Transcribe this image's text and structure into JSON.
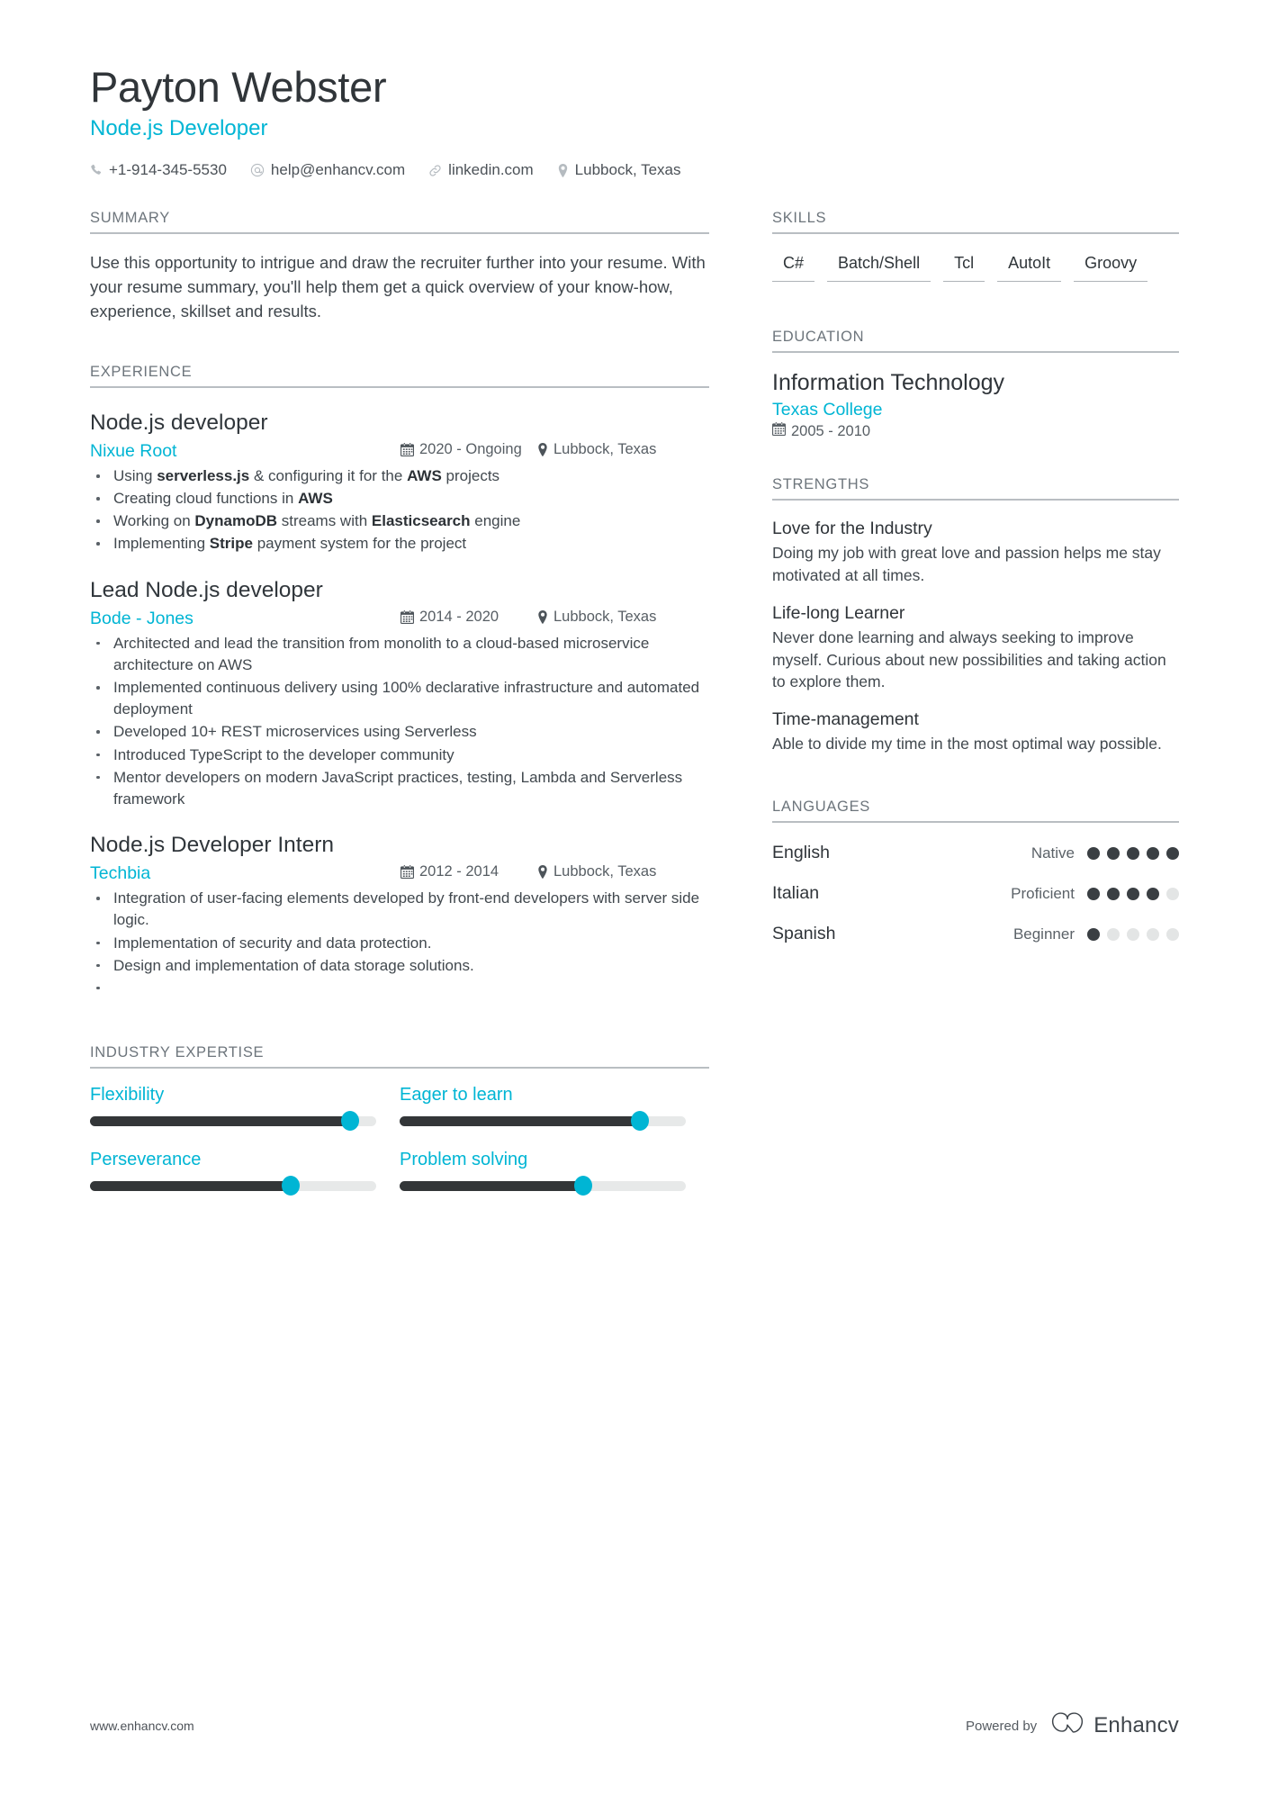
{
  "header": {
    "name": "Payton Webster",
    "job_title": "Node.js Developer",
    "contacts": [
      {
        "icon": "phone-icon",
        "text": "+1-914-345-5530"
      },
      {
        "icon": "email-icon",
        "text": "help@enhancv.com"
      },
      {
        "icon": "link-icon",
        "text": "linkedin.com"
      },
      {
        "icon": "location-icon",
        "text": "Lubbock, Texas"
      }
    ]
  },
  "colors": {
    "accent": "#00b5d4",
    "heading": "#6d757c",
    "text": "#3f464c",
    "slider_fill": "#333638",
    "slider_track": "#e7e9e9",
    "dot_on": "#3a3f43",
    "dot_off": "#e3e5e5"
  },
  "summary": {
    "heading": "SUMMARY",
    "text": "Use this opportunity to intrigue and draw the recruiter further into your resume. With your resume summary, you'll help them get a quick overview of your know-how, experience, skillset and results."
  },
  "experience": {
    "heading": "EXPERIENCE",
    "items": [
      {
        "title": "Node.js developer",
        "company": "Nixue Root",
        "date": "2020 - Ongoing",
        "location": "Lubbock, Texas",
        "bullets": [
          "Using <b>serverless.js</b> &amp; configuring it for the <b>AWS</b> projects",
          "Creating cloud functions in <b>AWS</b>",
          "Working on <b>DynamoDB</b> streams with <b>Elasticsearch</b> engine",
          "Implementing <b>Stripe</b> payment system for the project"
        ]
      },
      {
        "title": "Lead Node.js developer",
        "company": "Bode - Jones",
        "date": "2014 - 2020",
        "location": "Lubbock, Texas",
        "bullets": [
          "Architected and lead the transition from monolith to a cloud-based microservice architecture on AWS",
          "Implemented continuous delivery using 100% declarative infrastructure and automated deployment",
          "Developed 10+ REST microservices using Serverless",
          "Introduced TypeScript to the developer community",
          "Mentor developers on modern JavaScript practices, testing, Lambda and Serverless framework"
        ]
      },
      {
        "title": "Node.js Developer Intern",
        "company": "Techbia",
        "date": "2012 - 2014",
        "location": "Lubbock, Texas",
        "bullets": [
          "Integration of user-facing elements developed by front-end developers with server side logic.",
          "Implementation of security and data protection.",
          "Design and implementation of data storage solutions.",
          ""
        ]
      }
    ]
  },
  "industry_expertise": {
    "heading": "INDUSTRY EXPERTISE",
    "items": [
      {
        "label": "Flexibility",
        "value": 91
      },
      {
        "label": "Eager to learn",
        "value": 84
      },
      {
        "label": "Perseverance",
        "value": 70
      },
      {
        "label": "Problem solving",
        "value": 64
      }
    ]
  },
  "skills": {
    "heading": "SKILLS",
    "items": [
      "C#",
      "Batch/Shell",
      "Tcl",
      "AutoIt",
      "Groovy"
    ]
  },
  "education": {
    "heading": "EDUCATION",
    "items": [
      {
        "degree": "Information Technology",
        "school": "Texas College",
        "date": "2005 - 2010"
      }
    ]
  },
  "strengths": {
    "heading": "STRENGTHS",
    "items": [
      {
        "title": "Love for the Industry",
        "desc": "Doing my job with great love and passion helps me stay motivated at all times."
      },
      {
        "title": "Life-long Learner",
        "desc": "Never done learning and always seeking to improve myself. Curious about new possibilities and taking action to explore them."
      },
      {
        "title": "Time-management",
        "desc": "Able to divide my time in the most optimal way possible."
      }
    ]
  },
  "languages": {
    "heading": "LANGUAGES",
    "items": [
      {
        "name": "English",
        "level": "Native",
        "filled": 5,
        "total": 5
      },
      {
        "name": "Italian",
        "level": "Proficient",
        "filled": 4,
        "total": 5
      },
      {
        "name": "Spanish",
        "level": "Beginner",
        "filled": 1,
        "total": 5
      }
    ]
  },
  "footer": {
    "website": "www.enhancv.com",
    "powered_by": "Powered by",
    "brand": "Enhancv"
  }
}
